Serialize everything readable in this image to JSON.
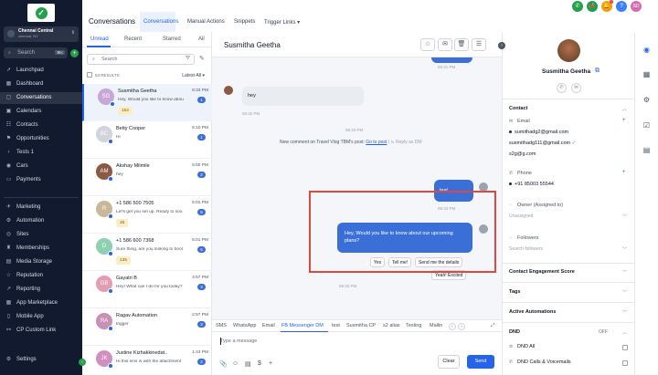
{
  "app": {
    "logo_icon": "check-circle-icon"
  },
  "account": {
    "name": "Chennai Central",
    "location": "chennai, NY"
  },
  "search": {
    "label": "Search",
    "shortcut": "⌘K"
  },
  "nav": [
    {
      "label": "Launchpad",
      "icon": "rocket-icon",
      "glyph": "➚"
    },
    {
      "label": "Dashboard",
      "icon": "grid-icon",
      "glyph": "▦"
    },
    {
      "label": "Conversations",
      "icon": "chat-icon",
      "glyph": "▢"
    },
    {
      "label": "Calendars",
      "icon": "calendar-icon",
      "glyph": "▣"
    },
    {
      "label": "Contacts",
      "icon": "contacts-icon",
      "glyph": "☷"
    },
    {
      "label": "Opportunities",
      "icon": "funnel-icon",
      "glyph": "⚑"
    },
    {
      "label": "Tests 1",
      "icon": "chevron-right-icon",
      "glyph": "›"
    },
    {
      "label": "Cars",
      "icon": "car-icon",
      "glyph": "◉"
    },
    {
      "label": "Payments",
      "icon": "card-icon",
      "glyph": "▭"
    },
    {
      "label": "Marketing",
      "icon": "megaphone-icon",
      "glyph": "✈"
    },
    {
      "label": "Automation",
      "icon": "automation-icon",
      "glyph": "⚙"
    },
    {
      "label": "Sites",
      "icon": "globe-icon",
      "glyph": "◎"
    },
    {
      "label": "Memberships",
      "icon": "membership-icon",
      "glyph": "♜"
    },
    {
      "label": "Media Storage",
      "icon": "folder-icon",
      "glyph": "▤"
    },
    {
      "label": "Reputation",
      "icon": "star-icon",
      "glyph": "☆"
    },
    {
      "label": "Reporting",
      "icon": "chart-icon",
      "glyph": "↗"
    },
    {
      "label": "App Marketplace",
      "icon": "apps-icon",
      "glyph": "▦"
    },
    {
      "label": "Mobile App",
      "icon": "phone-icon",
      "glyph": "▯"
    },
    {
      "label": "CP Custom Link",
      "icon": "link-icon",
      "glyph": "⚯"
    },
    {
      "label": "Settings",
      "icon": "gear-icon",
      "glyph": "⚙"
    }
  ],
  "header": {
    "title": "Conversations",
    "tabs": [
      "Conversations",
      "Manual Actions",
      "Snippets",
      "Trigger Links"
    ],
    "trigger_caret": "▾"
  },
  "colors": {
    "phone": "#22a04b",
    "megaphone": "#16a34a",
    "bell": "#f59e0b",
    "help": "#3b82f6",
    "avatar": "#d16db3",
    "accent": "#2563eb"
  },
  "topicons": {
    "user_initials": "SD",
    "help": "?"
  },
  "list": {
    "tabs": [
      "Unread",
      "Recent",
      "Starred",
      "All"
    ],
    "search_placeholder": "Search",
    "results": "53 RESULTS",
    "sort": "Latest-All",
    "conversations": [
      {
        "name": "Susmitha Geetha",
        "time": "6:33 PM",
        "preview": "Hey, Would you like to know abou",
        "badge": "1",
        "tag": "152",
        "initials": "SG",
        "color": "#c9a6d8"
      },
      {
        "name": "Betty Cooper",
        "time": "6:10 PM",
        "preview": "Hi",
        "badge": "1",
        "tag": "",
        "initials": "BC",
        "color": "#d1d5db"
      },
      {
        "name": "Akshay Milmile",
        "time": "5:50 PM",
        "preview": "hey",
        "badge": "2",
        "tag": "",
        "initials": "AM",
        "color": "#8a5a44"
      },
      {
        "name": "+1 586 500 7505",
        "time": "5:02 PM",
        "preview": "Let's get you set up. Ready to soo",
        "badge": "6",
        "tag": "25",
        "initials": "R",
        "color": "#c8b89a"
      },
      {
        "name": "+1 586 600 7368",
        "time": "5:01 PM",
        "preview": "Sure thing, are you looking to bool",
        "badge": "6",
        "tag": "135",
        "initials": "D",
        "color": "#8fd0b0"
      },
      {
        "name": "Gayatri B",
        "time": "4:57 PM",
        "preview": "Hey! What can I do for you today?",
        "badge": "3",
        "tag": "",
        "initials": "GB",
        "color": "#e29db0"
      },
      {
        "name": "Ragav Automation",
        "time": "2:57 PM",
        "preview": "trigger",
        "badge": "3",
        "tag": "",
        "initials": "RA",
        "color": "#c98fb6"
      },
      {
        "name": "Justine Kizhakkinedat..",
        "time": "1:43 PM",
        "preview": "Hi this sms is with the attachment",
        "badge": "2",
        "tag": "",
        "initials": "JK",
        "color": "#d08fbf"
      }
    ]
  },
  "chat": {
    "contact_name": "Susmitha Geetha",
    "header_buttons": [
      "☆",
      "✉",
      "🗑",
      "☰"
    ],
    "messages": [
      {
        "dir": "out",
        "text": "",
        "time": "06:31 PM"
      },
      {
        "dir": "in",
        "text": "hey",
        "time": "06:32 PM"
      },
      {
        "dir": "system_time",
        "text": "",
        "time": "06:33 PM"
      },
      {
        "dir": "out",
        "text": "test",
        "time": "06:33 PM"
      },
      {
        "dir": "out",
        "text": "Hey, Would you like to know about our upcoming plans?",
        "time": "06:33 PM"
      }
    ],
    "activity": {
      "prefix": "New comment on Travel Vlog TBM's post:",
      "link": "Go to post",
      "suffix": "| ↳ Reply as DM"
    },
    "quick_replies": [
      "Yes",
      "Tell me!",
      "Send me the details",
      "Yeah! Excited"
    ],
    "channels": [
      "SMS",
      "WhatsApp",
      "Email",
      "FB Messenger DM",
      "test",
      "Susmitha CP",
      "s2 alias",
      "Texting",
      "Mailin"
    ],
    "compose_placeholder": "Type a message",
    "tools": [
      "📎",
      "☺",
      "▤",
      "$",
      "+"
    ],
    "clear": "Clear",
    "send": "Send"
  },
  "contact": {
    "name": "Susmitha Geetha",
    "sections": {
      "contact": "Contact",
      "engagement": "Contact Engagement Score",
      "tags": "Tags",
      "automations": "Active Automations",
      "dnd": "DND"
    },
    "email_label": "Email",
    "emails": [
      "sumithadg2@gmail.com",
      "susmithadg111@gmail.com",
      "s2g@g.com"
    ],
    "phone_label": "Phone",
    "phones": [
      "+91 85003 55544"
    ],
    "owner_label": "Owner (Assigned to)",
    "owner_value": "Unassigned",
    "followers_label": "Followers",
    "followers_placeholder": "Search followers",
    "dnd_state": "OFF",
    "dnd_items": [
      "DND All",
      "DND Calls & Voicemails"
    ]
  },
  "rail": [
    {
      "icon": "user-circle-icon",
      "glyph": "◉"
    },
    {
      "icon": "calendar-icon",
      "glyph": "▦"
    },
    {
      "icon": "integration-icon",
      "glyph": "⚙"
    },
    {
      "icon": "task-check-icon",
      "glyph": "☑"
    },
    {
      "icon": "notes-icon",
      "glyph": "▤"
    }
  ]
}
